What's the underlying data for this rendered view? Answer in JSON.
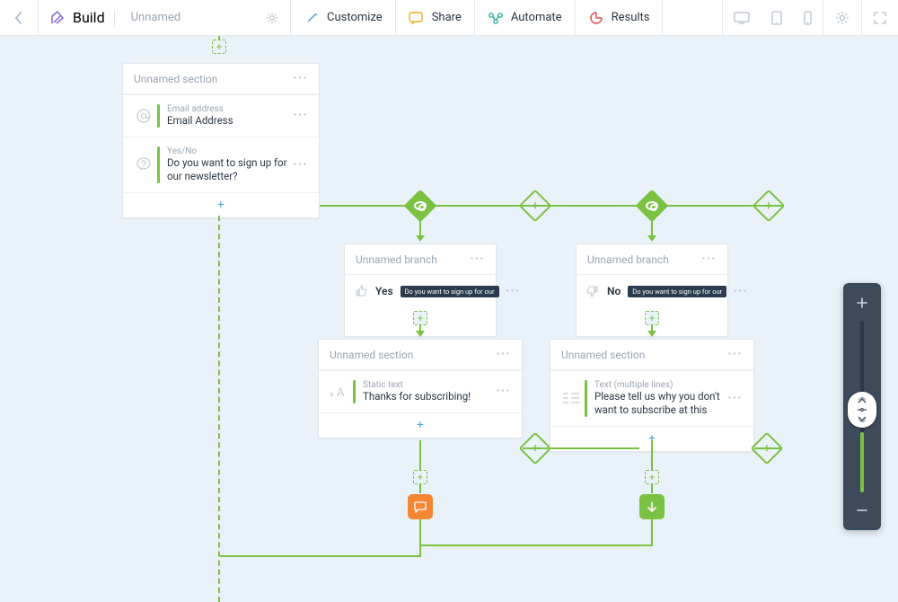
{
  "toolbar": {
    "build_label": "Build",
    "form_title": "Unnamed",
    "customize_label": "Customize",
    "share_label": "Share",
    "automate_label": "Automate",
    "results_label": "Results"
  },
  "root_section": {
    "title": "Unnamed section",
    "rows": [
      {
        "eyebrow": "Email address",
        "label": "Email Address"
      },
      {
        "eyebrow": "Yes/No",
        "label": "Do you want to sign up for our newsletter?"
      }
    ]
  },
  "branches": [
    {
      "title": "Unnamed branch",
      "answer": "Yes",
      "chip": "Do you want to sign up for our",
      "child_section": {
        "title": "Unnamed section",
        "row": {
          "eyebrow": "Static text",
          "label": "Thanks for subscribing!"
        }
      }
    },
    {
      "title": "Unnamed branch",
      "answer": "No",
      "chip": "Do you want to sign up for our",
      "child_section": {
        "title": "Unnamed section",
        "row": {
          "eyebrow": "Text (multiple lines)",
          "label": "Please tell us why you don't want to subscribe at this"
        }
      }
    }
  ],
  "colors": {
    "green": "#7bc142",
    "orange": "#f58634",
    "blue": "#4aa3df",
    "purple": "#7b68ee",
    "red": "#e84c4c",
    "amber": "#f7a823",
    "teal": "#2bb3a3"
  }
}
